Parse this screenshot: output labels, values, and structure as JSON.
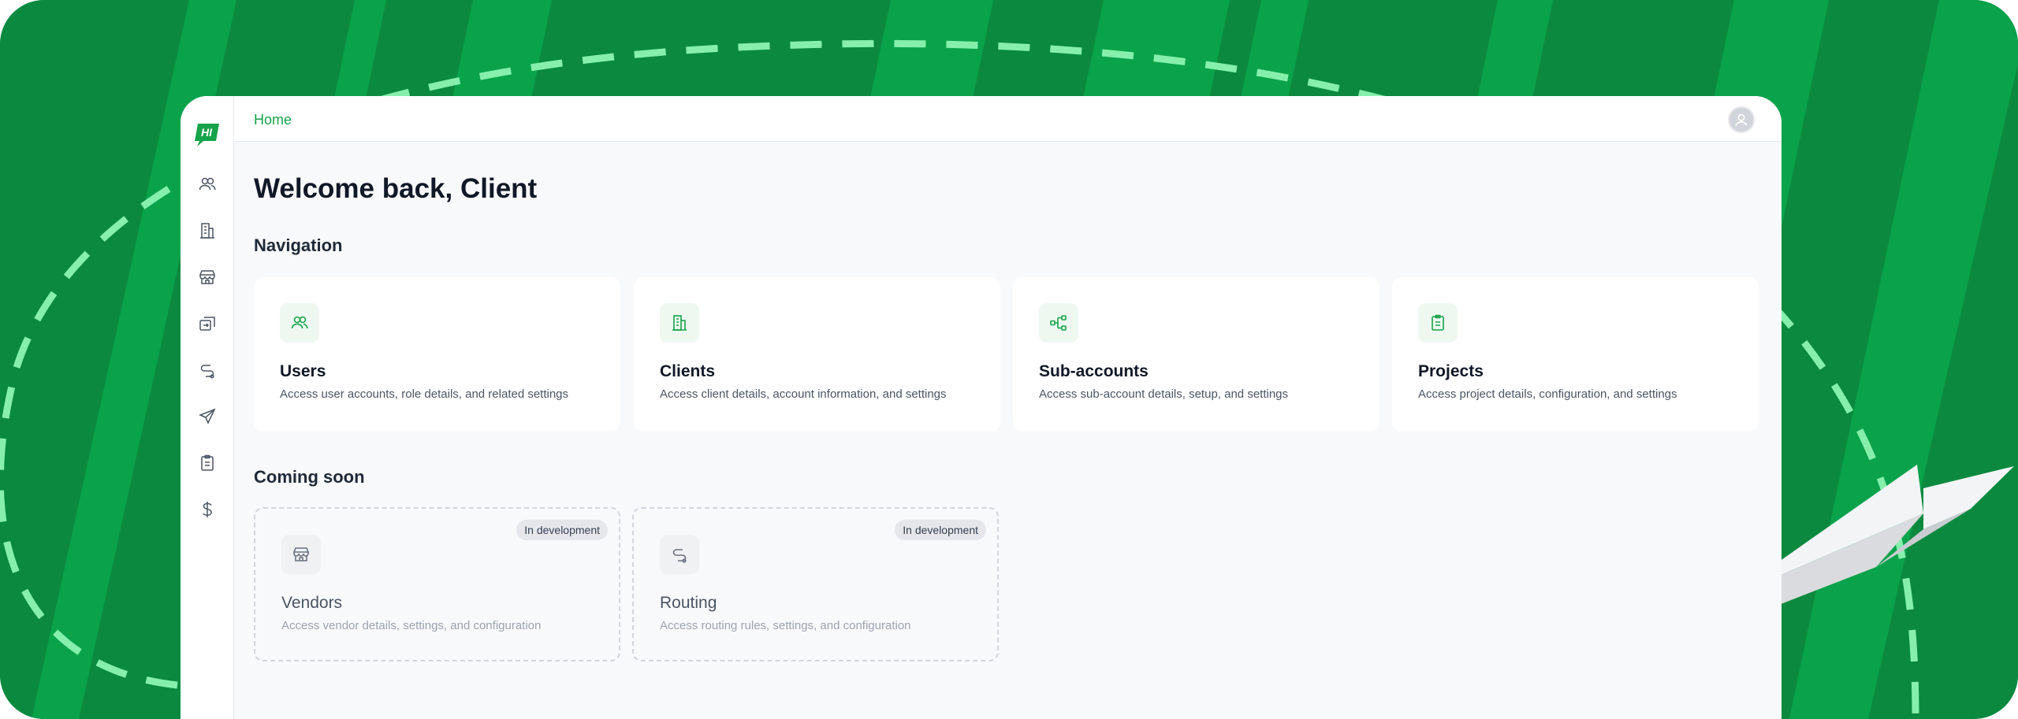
{
  "colors": {
    "brand": "#16a34a",
    "background": "#0b8a3f",
    "dash": "#86efac"
  },
  "sidebar": {
    "logo_text": "HI",
    "items": [
      {
        "icon": "users-icon"
      },
      {
        "icon": "building-icon"
      },
      {
        "icon": "store-icon"
      },
      {
        "icon": "transfer-icon"
      },
      {
        "icon": "route-icon"
      },
      {
        "icon": "paper-plane-icon"
      },
      {
        "icon": "clipboard-icon"
      },
      {
        "icon": "dollar-icon"
      }
    ]
  },
  "header": {
    "breadcrumb": "Home",
    "avatar_icon": "user-icon"
  },
  "main": {
    "title": "Welcome back, Client",
    "navigation": {
      "heading": "Navigation",
      "cards": [
        {
          "icon": "users-icon",
          "title": "Users",
          "description": "Access user accounts, role details, and related settings"
        },
        {
          "icon": "building-icon",
          "title": "Clients",
          "description": "Access client details, account information, and settings"
        },
        {
          "icon": "hierarchy-icon",
          "title": "Sub-accounts",
          "description": "Access sub-account details, setup, and settings"
        },
        {
          "icon": "clipboard-icon",
          "title": "Projects",
          "description": "Access project details, configuration, and settings"
        }
      ]
    },
    "coming_soon": {
      "heading": "Coming soon",
      "cards": [
        {
          "icon": "store-icon",
          "title": "Vendors",
          "description": "Access vendor details, settings, and configuration",
          "badge": "In development"
        },
        {
          "icon": "route-icon",
          "title": "Routing",
          "description": "Access routing rules, settings, and configuration",
          "badge": "In development"
        }
      ]
    }
  }
}
